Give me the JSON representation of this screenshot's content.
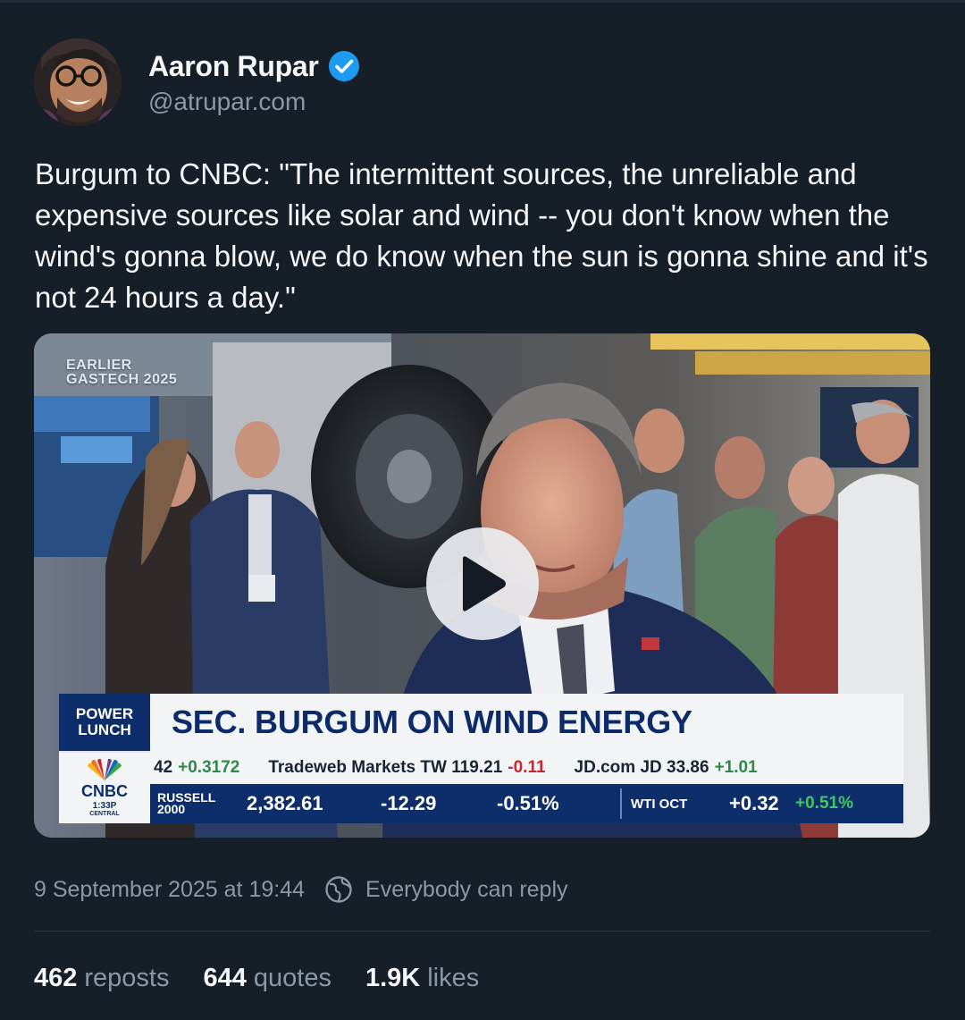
{
  "author": {
    "name": "Aaron Rupar",
    "handle": "@atrupar.com",
    "verified": true
  },
  "post": {
    "text": "Burgum to CNBC: \"The intermittent sources, the unreliable and expensive sources like solar and wind -- you don't know when the wind's gonna blow, we do know when the sun is gonna shine and it's not 24 hours a day.\"",
    "date": "9 September 2025 at 19:44",
    "reply_setting": "Everybody can reply"
  },
  "video": {
    "overlay_line1": "EARLIER",
    "overlay_line2": "GASTECH 2025",
    "show_line1": "POWER",
    "show_line2": "LUNCH",
    "headline": "SEC. BURGUM ON WIND ENERGY",
    "network": "CNBC",
    "time": "1:33P",
    "timezone": "CENTRAL",
    "ticker_top": [
      {
        "label": "42",
        "change": "+0.3172",
        "dir": "up"
      },
      {
        "label": "Tradeweb Markets TW 119.21",
        "change": "-0.11",
        "dir": "down"
      },
      {
        "label": "JD.com JD 33.86",
        "change": "+1.01",
        "dir": "up"
      }
    ],
    "russell_line1": "RUSSELL",
    "russell_line2": "2000",
    "russell_value": "2,382.61",
    "russell_change": "-12.29",
    "russell_pct": "-0.51%",
    "wti_name": "WTI OCT",
    "wti_change": "+0.32",
    "wti_pct": "+0.51%"
  },
  "stats": {
    "reposts_count": "462",
    "reposts_label": "reposts",
    "quotes_count": "644",
    "quotes_label": "quotes",
    "likes_count": "1.9K",
    "likes_label": "likes"
  },
  "colors": {
    "background": "#161e27",
    "verified_blue": "#1d9bf0",
    "cnbc_navy": "#0d2e6b",
    "muted_text": "#8b98a5"
  }
}
